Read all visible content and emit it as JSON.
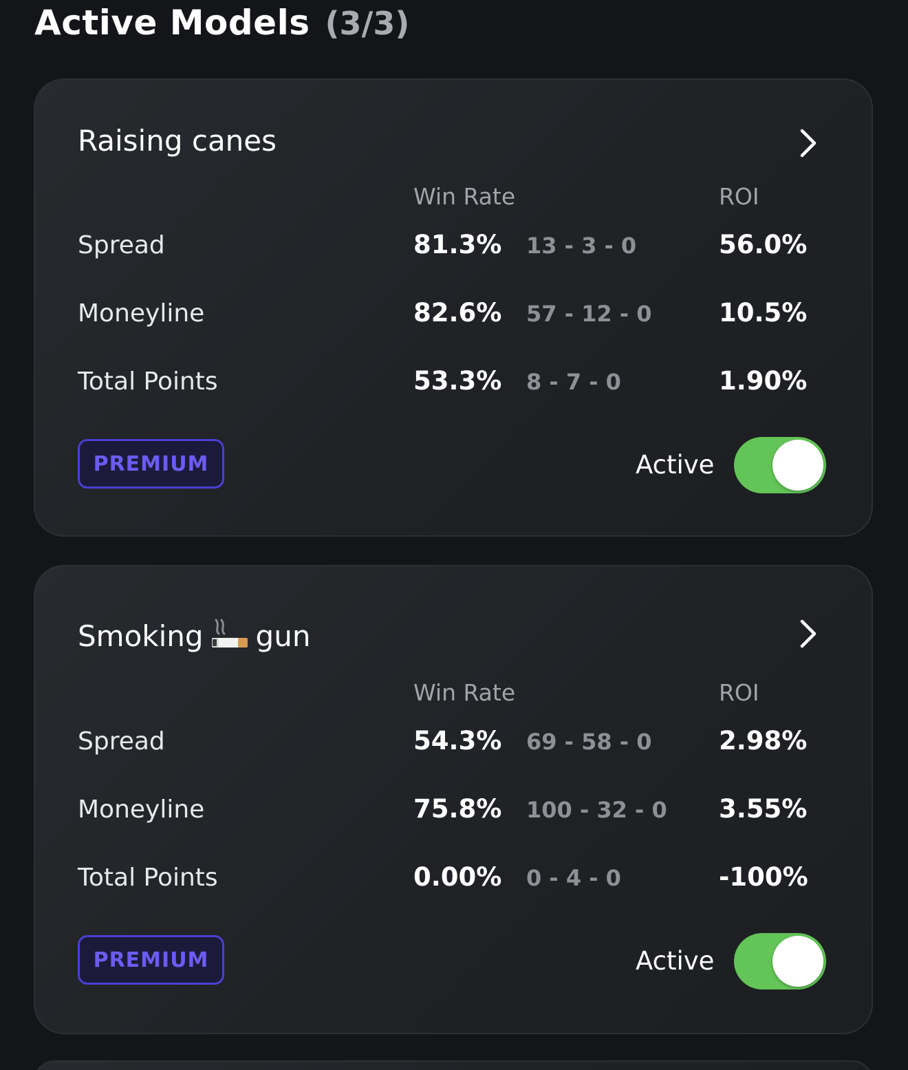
{
  "header": {
    "title": "Active Models",
    "count": "(3/3)"
  },
  "columns": {
    "win_rate": "Win Rate",
    "roi": "ROI"
  },
  "models": [
    {
      "name": "Raising canes",
      "rows": [
        {
          "label": "Spread",
          "win_rate": "81.3%",
          "record": "13 - 3 - 0",
          "roi": "56.0%"
        },
        {
          "label": "Moneyline",
          "win_rate": "82.6%",
          "record": "57 - 12 - 0",
          "roi": "10.5%"
        },
        {
          "label": "Total Points",
          "win_rate": "53.3%",
          "record": "8 - 7 - 0",
          "roi": "1.90%"
        }
      ],
      "badge": "PREMIUM",
      "status_label": "Active",
      "toggle_on": true
    },
    {
      "name_before": "Smoking",
      "name_icon": "cigarette-emoji",
      "name_after": "gun",
      "rows": [
        {
          "label": "Spread",
          "win_rate": "54.3%",
          "record": "69 - 58 - 0",
          "roi": "2.98%"
        },
        {
          "label": "Moneyline",
          "win_rate": "75.8%",
          "record": "100 - 32 - 0",
          "roi": "3.55%"
        },
        {
          "label": "Total Points",
          "win_rate": "0.00%",
          "record": "0 - 4 - 0",
          "roi": "-100%"
        }
      ],
      "badge": "PREMIUM",
      "status_label": "Active",
      "toggle_on": true
    }
  ],
  "colors": {
    "background": "#141518",
    "card": "#232629",
    "premium_border": "#4a3fd3",
    "premium_text": "#6a5cf2",
    "toggle_on": "#63c457"
  }
}
